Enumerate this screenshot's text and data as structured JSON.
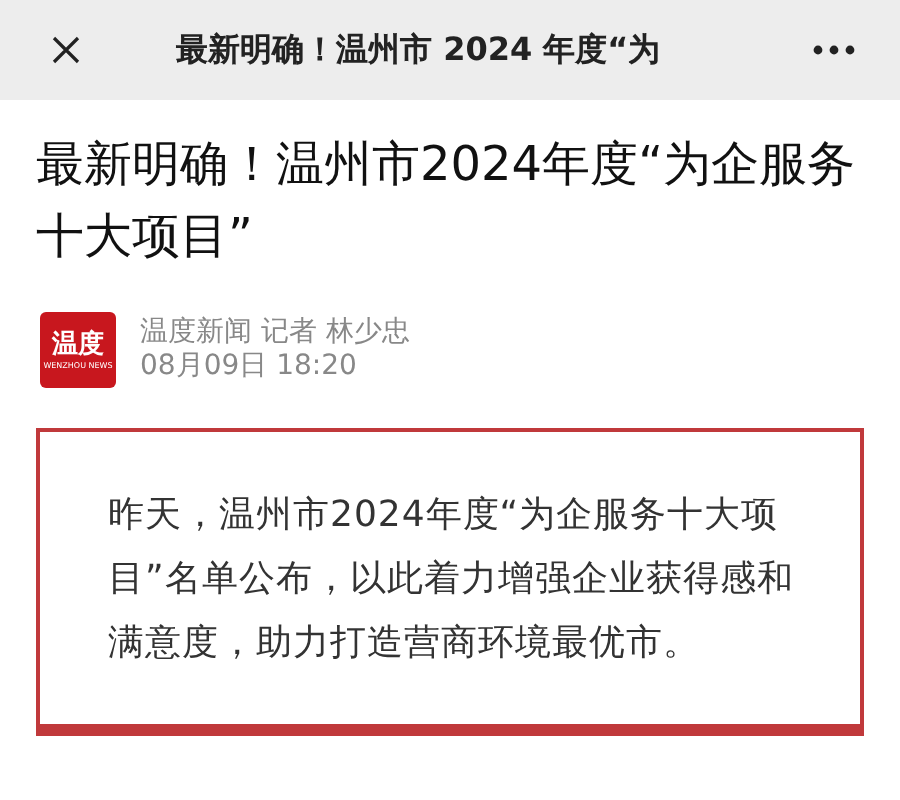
{
  "nav_bar": {
    "title": "最新明确！温州市 2024 年度“为"
  },
  "article": {
    "headline": "最新明确！温州市2024年度“为企服务十大项目”",
    "logo": {
      "mark": "温度",
      "tagline": "WENZHOU NEWS"
    },
    "byline": "温度新闻 记者 林少忠",
    "time": "08月09日 18:20",
    "summary": "昨天，温州市2024年度“为企服务十大项目”名单公布，以此着力增强企业获得感和满意度，助力打造营商环境最优市。"
  }
}
